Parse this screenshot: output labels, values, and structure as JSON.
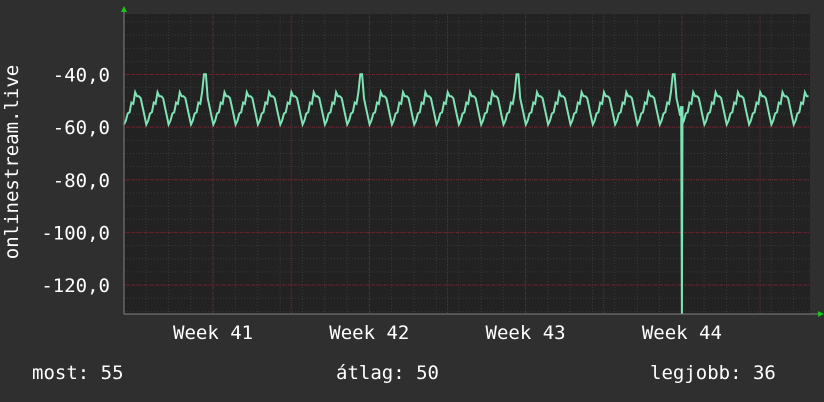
{
  "colors": {
    "background": "#2f2f2f",
    "plot_background": "#222222",
    "grid_minor": "#3a3a3a",
    "grid_major": "#6b2a34",
    "line": "#7fe3b5",
    "axis_arrow": "#19c419"
  },
  "chart_data": {
    "type": "line",
    "ylabel": "onlinestream.live",
    "ylim": [
      -131,
      -17
    ],
    "yticks": [
      "-40,0",
      "-60,0",
      "-80,0",
      "-100,0",
      "-120,0"
    ],
    "ytick_values": [
      -40,
      -60,
      -80,
      -100,
      -120
    ],
    "xticks": [
      "Week 41",
      "Week 42",
      "Week 43",
      "Week 44"
    ],
    "xtick_positions": [
      41,
      42,
      43,
      44
    ],
    "xlim": [
      40.43,
      44.82
    ],
    "grid": true,
    "series": [
      {
        "cycle_days": 1,
        "x_start": 40.43,
        "x_end": 44.82,
        "daily_low": -59,
        "daily_high": -47,
        "weekly_peak": -36,
        "outlier": {
          "x": 44.0,
          "value": -131
        }
      }
    ]
  },
  "stats": {
    "current": "most: 55",
    "average": "átlag: 50",
    "best": "legjobb: 36"
  }
}
